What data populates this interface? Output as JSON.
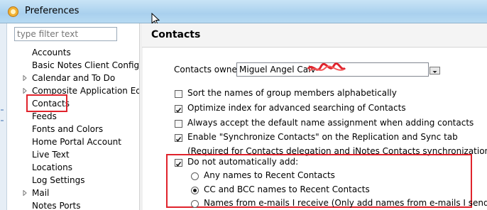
{
  "window": {
    "title": "Preferences"
  },
  "filter": {
    "placeholder": "type filter text"
  },
  "tree": {
    "items": [
      {
        "label": "Accounts",
        "expandable": false
      },
      {
        "label": "Basic Notes Client Configura",
        "expandable": false
      },
      {
        "label": "Calendar and To Do",
        "expandable": true
      },
      {
        "label": "Composite Application Edito",
        "expandable": true
      },
      {
        "label": "Contacts",
        "expandable": false,
        "selected": true
      },
      {
        "label": "Feeds",
        "expandable": false
      },
      {
        "label": "Fonts and Colors",
        "expandable": false
      },
      {
        "label": "Home Portal Account",
        "expandable": false
      },
      {
        "label": "Live Text",
        "expandable": false
      },
      {
        "label": "Locations",
        "expandable": false
      },
      {
        "label": "Log Settings",
        "expandable": false
      },
      {
        "label": "Mail",
        "expandable": true
      },
      {
        "label": "Notes Ports",
        "expandable": false
      }
    ]
  },
  "page": {
    "title": "Contacts",
    "owner_label": "Contacts owner:",
    "owner_value": "Miguel Angel Calv",
    "options": [
      {
        "label": "Sort the names of group members alphabetically",
        "checked": false
      },
      {
        "label": "Optimize index for advanced searching of Contacts",
        "checked": true
      },
      {
        "label": "Always accept the default name assignment when adding contacts",
        "checked": false
      },
      {
        "label": "Enable \"Synchronize Contacts\" on the Replication and Sync tab",
        "checked": true
      }
    ],
    "sync_note": "(Required for Contacts delegation and iNotes Contacts synchronization)",
    "do_not_add": {
      "label": "Do not automatically add:",
      "checked": true
    },
    "radios": [
      {
        "label": "Any names to Recent Contacts",
        "selected": false
      },
      {
        "label": "CC and BCC names to Recent Contacts",
        "selected": true
      },
      {
        "label": "Names from e-mails I receive (Only add names from e-mails I send)",
        "selected": false
      }
    ]
  },
  "colors": {
    "annotation": "#e0232c",
    "title_bar": "#b7daf2"
  }
}
